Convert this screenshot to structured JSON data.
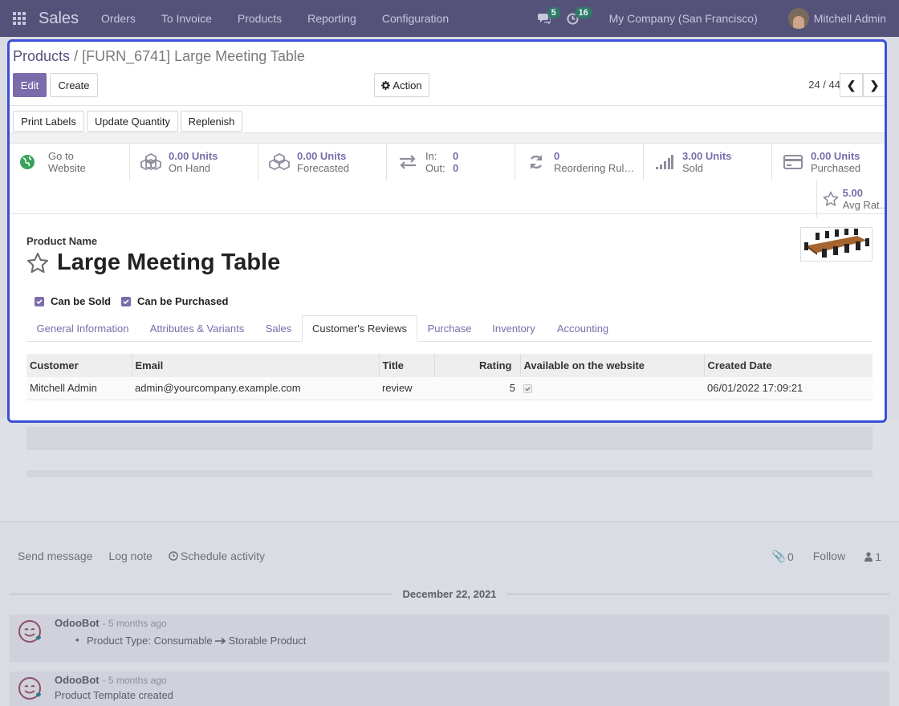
{
  "topbar": {
    "app_title": "Sales",
    "menu": [
      "Orders",
      "To Invoice",
      "Products",
      "Reporting",
      "Configuration"
    ],
    "messages_count": "5",
    "activities_count": "16",
    "company": "My Company (San Francisco)",
    "user": "Mitchell Admin"
  },
  "breadcrumb": {
    "parent": "Products",
    "separator": "/",
    "current": "[FURN_6741] Large Meeting Table"
  },
  "controls": {
    "edit": "Edit",
    "create": "Create",
    "action": "Action",
    "pager": "24 / 44"
  },
  "header_buttons": [
    "Print Labels",
    "Update Quantity",
    "Replenish"
  ],
  "stats": {
    "website": {
      "line1": "Go to",
      "line2": "Website"
    },
    "on_hand": {
      "value": "0.00 Units",
      "label": "On Hand"
    },
    "forecasted": {
      "value": "0.00 Units",
      "label": "Forecasted"
    },
    "in_out": {
      "in_label": "In:",
      "in_value": "0",
      "out_label": "Out:",
      "out_value": "0"
    },
    "reordering": {
      "value": "0",
      "label": "Reordering Rul…"
    },
    "sold": {
      "value": "3.00 Units",
      "label": "Sold"
    },
    "purchased": {
      "value": "0.00 Units",
      "label": "Purchased"
    },
    "rating": {
      "value": "5.00",
      "label": "Avg Rat…"
    }
  },
  "product": {
    "name_label": "Product Name",
    "name": "Large Meeting Table",
    "can_be_sold": "Can be Sold",
    "can_be_purchased": "Can be Purchased"
  },
  "tabs": [
    "General Information",
    "Attributes & Variants",
    "Sales",
    "Customer's Reviews",
    "Purchase",
    "Inventory",
    "Accounting"
  ],
  "reviews": {
    "columns": [
      "Customer",
      "Email",
      "Title",
      "Rating",
      "Available on the website",
      "Created Date"
    ],
    "rows": [
      {
        "customer": "Mitchell Admin",
        "email": "admin@yourcompany.example.com",
        "title": "review",
        "rating": "5",
        "created": "06/01/2022 17:09:21"
      }
    ]
  },
  "chatter": {
    "send_message": "Send message",
    "log_note": "Log note",
    "schedule_activity": "Schedule activity",
    "attachments": "0",
    "follow": "Follow",
    "followers": "1",
    "date": "December 22, 2021",
    "messages": [
      {
        "author": "OdooBot",
        "ago": "- 5 months ago",
        "text_prefix": "Product Type: Consumable",
        "text_suffix": "Storable Product"
      },
      {
        "author": "OdooBot",
        "ago": "- 5 months ago",
        "text": "Product Template created"
      }
    ]
  },
  "colors": {
    "primary": "#7a6cab",
    "navbar": "#55527a",
    "focus_border": "#3b4fd8"
  }
}
